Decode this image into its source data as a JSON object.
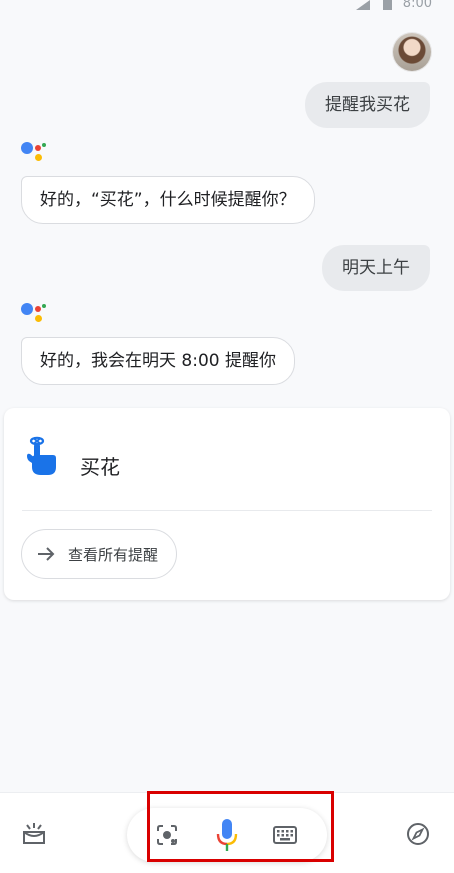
{
  "status_bar": {
    "time": "8:00"
  },
  "conversation": {
    "messages": [
      {
        "role": "user",
        "text": "提醒我买花"
      },
      {
        "role": "assistant",
        "text": "好的，“买花”，什么时候提醒你？"
      },
      {
        "role": "user",
        "text": "明天上午"
      },
      {
        "role": "assistant",
        "text": "好的，我会在明天 8:00 提醒你"
      }
    ]
  },
  "reminder_card": {
    "title": "买花",
    "icon": "reminder-finger-icon",
    "view_all_label": "查看所有提醒"
  },
  "bottom_bar": {
    "icons": [
      "updates-icon",
      "lens-icon",
      "mic-icon",
      "keyboard-icon",
      "explore-compass-icon"
    ]
  },
  "colors": {
    "google_blue": "#4285f4",
    "google_red": "#ea4335",
    "google_yellow": "#fbbc05",
    "google_green": "#34a853",
    "highlight_box": "#d90000"
  }
}
